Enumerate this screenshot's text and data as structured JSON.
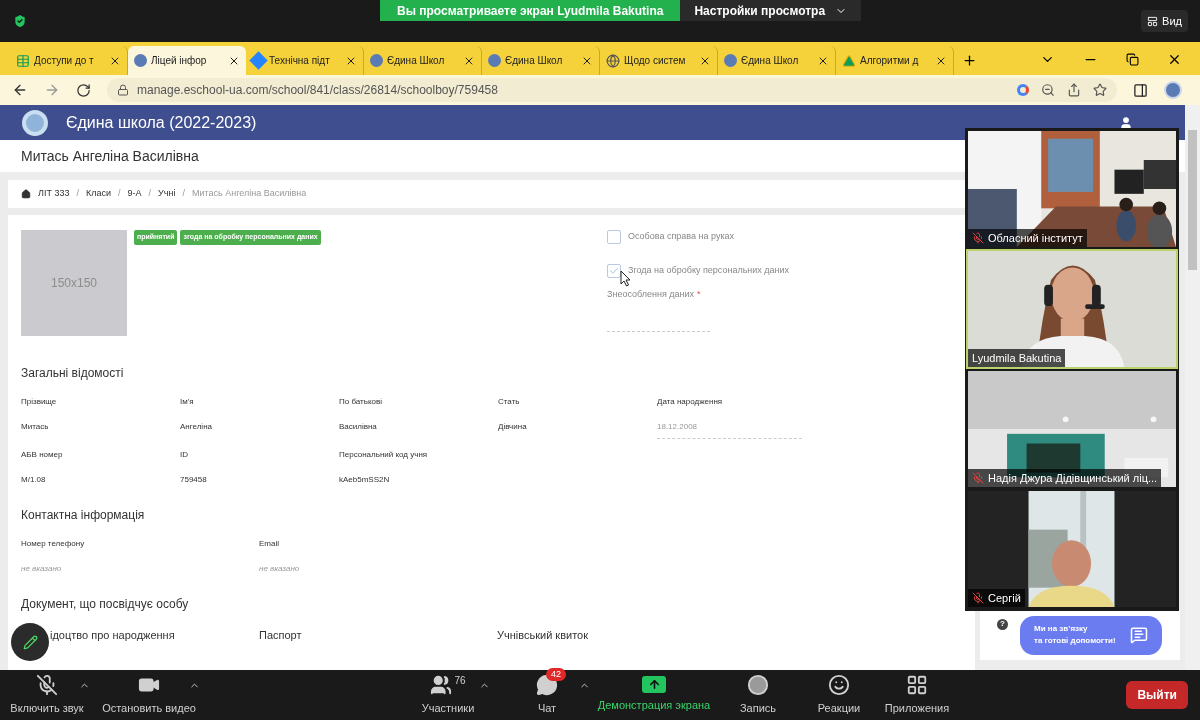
{
  "zoom_banner": {
    "text": "Вы просматриваете экран Lyudmila Bakutina",
    "settings": "Настройки просмотра",
    "view": "Вид"
  },
  "tabs": [
    {
      "label": "Доступи до т",
      "selected": false
    },
    {
      "label": "Ліцей інфор",
      "selected": true
    },
    {
      "label": "Технічна підт",
      "selected": false
    },
    {
      "label": "Єдина Школ",
      "selected": false
    },
    {
      "label": "Єдина Школ",
      "selected": false
    },
    {
      "label": "Щодо систем",
      "selected": false
    },
    {
      "label": "Єдина Школ",
      "selected": false
    },
    {
      "label": "Алгоритми д",
      "selected": false
    }
  ],
  "address": {
    "url": "manage.eschool-ua.com/school/841/class/26814/schoolboy/759458"
  },
  "app_title": "Єдина школа (2022-2023)",
  "student_name": "Митась Ангеліна Василівна",
  "breadcrumb": [
    {
      "label": "ЛІТ 333",
      "current": false
    },
    {
      "label": "Класи",
      "current": false
    },
    {
      "label": "9-А",
      "current": false
    },
    {
      "label": "Учні",
      "current": false
    },
    {
      "label": "Митась Ангеліна Василівна",
      "current": true
    }
  ],
  "breadcrumb_separator": "/",
  "photo_placeholder": "150x150",
  "badges": [
    "прийнятий",
    "згода на обробку персональних даних"
  ],
  "checkboxes": [
    {
      "label": "Особова справа на руках",
      "checked": false
    },
    {
      "label": "Згода на обробку персональних даних",
      "checked": true
    }
  ],
  "anonymization": {
    "label": "Знеособлення даних",
    "required": "*"
  },
  "sections": [
    {
      "title": "Загальні відомості",
      "kind": "general",
      "fields": [
        {
          "label": "Прізвище",
          "value": "Митась",
          "kind": "text"
        },
        {
          "label": "Ім'я",
          "value": "Ангеліна",
          "kind": "text"
        },
        {
          "label": "По батькові",
          "value": "Василівна",
          "kind": "text"
        },
        {
          "label": "Стать",
          "value": "Дівчина",
          "kind": "text"
        },
        {
          "label": "Дата народження",
          "value": "18.12.2008",
          "kind": "input"
        },
        {
          "label": "АБВ номер",
          "value": "М/1.08",
          "kind": "text"
        },
        {
          "label": "ID",
          "value": "759458",
          "kind": "text"
        },
        {
          "label": "Персональний код учня",
          "value": "kAeb5mSS2N",
          "kind": "text"
        }
      ]
    },
    {
      "title": "Контактна інформація",
      "kind": "contacts",
      "fields": [
        {
          "label": "Номер телефону",
          "value": "не вказано",
          "kind": "empty"
        },
        {
          "label": "Email",
          "value": "не вказано",
          "kind": "empty"
        }
      ]
    },
    {
      "title": "Документ, що посвідчує особу",
      "kind": "documents",
      "fields": [
        {
          "label": "ідоцтво про народження",
          "kind": "heading"
        },
        {
          "label": "Паспорт",
          "kind": "heading"
        },
        {
          "label": "Учнівський квиток",
          "kind": "heading"
        }
      ]
    }
  ],
  "participants": [
    {
      "name": "Обласний інститут",
      "muted": true,
      "speaking": false
    },
    {
      "name": "Lyudmila Bakutina",
      "muted": false,
      "speaking": true
    },
    {
      "name": "Надія Джура Дідівщинський ліц...",
      "muted": true,
      "speaking": false
    },
    {
      "name": "Сергій",
      "muted": true,
      "speaking": false
    }
  ],
  "help": {
    "icon_text": "?",
    "message_line1": "Ми на зв’язку",
    "message_line2": "та готові допомогти!"
  },
  "toolbar": [
    {
      "kind": "mic",
      "label": "Включить звук",
      "caret": true
    },
    {
      "kind": "video",
      "label": "Остановить видео",
      "caret": true
    },
    {
      "kind": "participants",
      "label": "Участники",
      "count": "76",
      "caret": true
    },
    {
      "kind": "chat",
      "label": "Чат",
      "badge": "42",
      "caret": true
    },
    {
      "kind": "share",
      "label": "Демонстрация экрана",
      "caret": false
    },
    {
      "kind": "record",
      "label": "Запись",
      "caret": false
    },
    {
      "kind": "reactions",
      "label": "Реакции",
      "caret": false
    },
    {
      "kind": "apps",
      "label": "Приложения",
      "caret": false
    }
  ],
  "leave_button": "Выйти"
}
